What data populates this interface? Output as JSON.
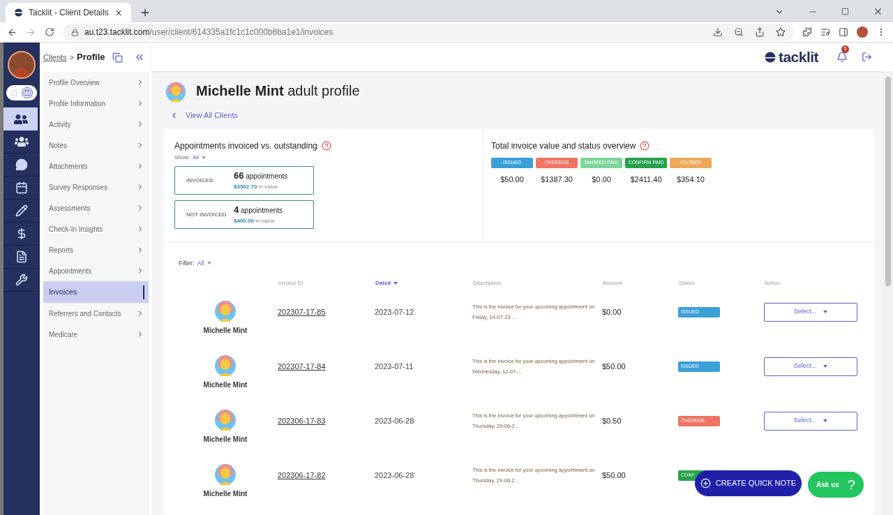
{
  "browser": {
    "tab_title": "Tacklit - Client Details",
    "url_host": "au.t23.tacklit.com",
    "url_path": "/user/client/614335a1fc1c1c000b6ba1e1/invoices"
  },
  "mode_toggle": [
    {
      "kind": "bookmark",
      "selected": false
    },
    {
      "kind": "briefcase",
      "selected": true
    }
  ],
  "nav_icons": [
    {
      "kind": "clients",
      "selected": true
    },
    {
      "kind": "groups",
      "selected": false
    },
    {
      "kind": "chat",
      "selected": false
    },
    {
      "kind": "calendar",
      "selected": false
    },
    {
      "kind": "pen",
      "selected": false
    },
    {
      "kind": "dollar",
      "selected": false
    },
    {
      "kind": "doc",
      "selected": false
    },
    {
      "kind": "wrench",
      "selected": false
    }
  ],
  "breadcrumb": {
    "link": "Clients",
    "separator": ">",
    "current": "Profile"
  },
  "submenu": [
    {
      "label": "Profile Overview",
      "selected": false
    },
    {
      "label": "Profile Information",
      "selected": false
    },
    {
      "label": "Activity",
      "selected": false
    },
    {
      "label": "Notes",
      "selected": false
    },
    {
      "label": "Attachments",
      "selected": false
    },
    {
      "label": "Survey Responses",
      "selected": false
    },
    {
      "label": "Assessments",
      "selected": false
    },
    {
      "label": "Check-In Insights",
      "selected": false
    },
    {
      "label": "Reports",
      "selected": false
    },
    {
      "label": "Appointments",
      "selected": false
    },
    {
      "label": "Invoices",
      "selected": true
    },
    {
      "label": "Referrers and Contacts",
      "selected": false
    },
    {
      "label": "Medicare",
      "selected": false
    }
  ],
  "header": {
    "logo": "tacklit",
    "notification_count": "5"
  },
  "client": {
    "name": "Michelle Mint",
    "suffix": "adult profile",
    "back_link": "View All Clients"
  },
  "appointments_panel": {
    "title": "Appointments invoiced vs. outstanding",
    "show_label": "Show:",
    "show_value": "All",
    "stats": [
      {
        "label": "INVOICED",
        "count": "66",
        "unit": "appointments",
        "value": "$3502.70",
        "value_suffix": "in value"
      },
      {
        "label": "NOT INVOICED",
        "count": "4",
        "unit": "appointments",
        "value": "$400.00",
        "value_suffix": "in value"
      }
    ]
  },
  "status_panel": {
    "title": "Total invoice value and status overview",
    "statuses": [
      {
        "label": "ISSUED",
        "amount": "$50.00",
        "color": "#3aa0d8"
      },
      {
        "label": "OVERDUE",
        "amount": "$1387.30",
        "color": "#ef7463"
      },
      {
        "label": "MARKED PAID",
        "amount": "$0.00",
        "color": "#7ed69a"
      },
      {
        "label": "CONFIRM PAID",
        "amount": "$2411.40",
        "color": "#27a24a"
      },
      {
        "label": "CLOSED",
        "amount": "$354.10",
        "color": "#eba95a"
      }
    ]
  },
  "filter": {
    "label": "Filter:",
    "value": "All"
  },
  "table": {
    "columns": [
      {
        "label": "Invoice ID",
        "sorted": false
      },
      {
        "label": "Dated",
        "sorted": true
      },
      {
        "label": "Description",
        "sorted": false
      },
      {
        "label": "Amount",
        "sorted": false
      },
      {
        "label": "Status",
        "sorted": false
      },
      {
        "label": "Action",
        "sorted": false
      }
    ],
    "rows": [
      {
        "name": "Michelle Mint",
        "invoice_id": "202307-17-85",
        "date": "2023-07-12",
        "description": "This is the invoice for your upcoming appointment on Friday, 14-07-23 ...",
        "amount": "$0.00",
        "status": "ISSUED",
        "color": "#3aa0d8",
        "action": "Select..."
      },
      {
        "name": "Michelle Mint",
        "invoice_id": "202307-17-84",
        "date": "2023-07-11",
        "description": "This is the invoice for your upcoming appointment on Wednesday, 12-07-...",
        "amount": "$50.00",
        "status": "ISSUED",
        "color": "#3aa0d8",
        "action": "Select..."
      },
      {
        "name": "Michelle Mint",
        "invoice_id": "202306-17-83",
        "date": "2023-06-28",
        "description": "This is the invoice for your upcoming appointment on Thursday, 29-06-2...",
        "amount": "$0.50",
        "status": "OVERDUE",
        "color": "#ef7463",
        "action": "Select..."
      },
      {
        "name": "Michelle Mint",
        "invoice_id": "202306-17-82",
        "date": "2023-06-28",
        "description": "This is the invoice for your upcoming appointment on Thursday, 29-06-2...",
        "amount": "$50.00",
        "status": "CONF",
        "color": "#27a24a"
      }
    ]
  },
  "quick_note": "CREATE QUICK NOTE",
  "ask_us": {
    "label": "Ask us",
    "mark": "?"
  }
}
